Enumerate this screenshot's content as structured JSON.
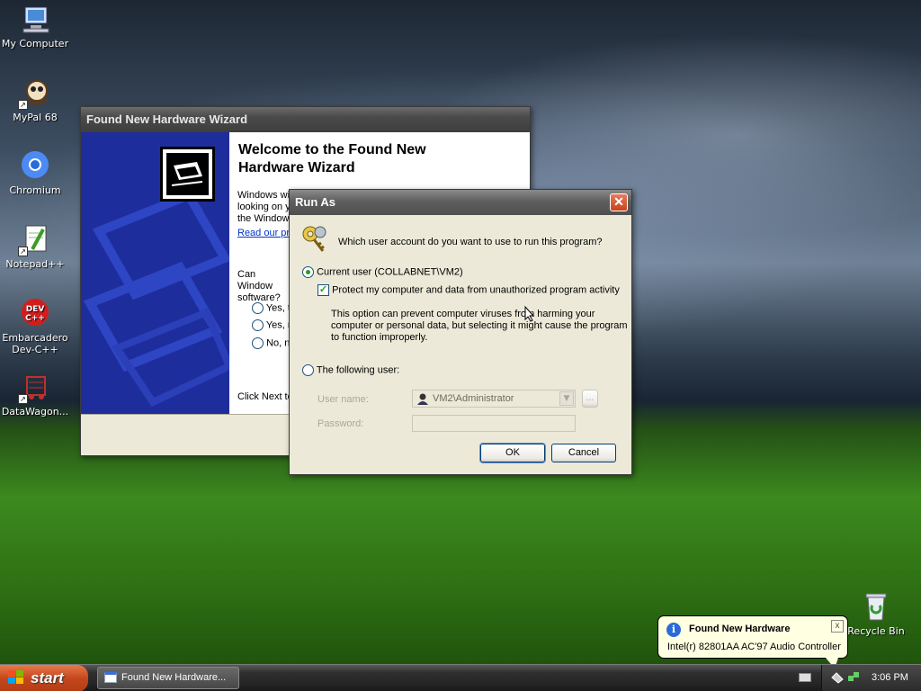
{
  "desktop": {
    "icons": [
      {
        "label": "My Computer"
      },
      {
        "label": "MyPal 68"
      },
      {
        "label": "Chromium"
      },
      {
        "label": "Notepad++"
      },
      {
        "label": "Embarcadero Dev-C++"
      },
      {
        "label": "DataWagon..."
      },
      {
        "label": "Recycle Bin"
      }
    ]
  },
  "wizard": {
    "title": "Found New Hardware Wizard",
    "heading": "Welcome to the Found New Hardware Wizard",
    "intro": "Windows wi looking on y the Window",
    "link": "Read our pr",
    "question": "Can Window software?",
    "options": [
      "Yes, t",
      "Yes, r",
      "No, n"
    ],
    "footer": "Click Next to"
  },
  "runas": {
    "title": "Run As",
    "prompt": "Which user account do you want to use to run this program?",
    "current_user_label": "Current user (COLLABNET\\VM2)",
    "protect_label": "Protect my computer and data from unauthorized program activity",
    "protect_note": "This option can prevent computer viruses from harming your computer or personal data, but selecting it might cause the program to function improperly.",
    "following_user_label": "The following user:",
    "username_label": "User name:",
    "username_value": "VM2\\Administrator",
    "password_label": "Password:",
    "browse_label": "...",
    "ok_label": "OK",
    "cancel_label": "Cancel"
  },
  "balloon": {
    "title": "Found New Hardware",
    "text": "Intel(r) 82801AA AC'97 Audio Controller",
    "close": "x"
  },
  "taskbar": {
    "start_label": "start",
    "task_label": "Found New Hardware...",
    "clock": "3:06 PM"
  }
}
